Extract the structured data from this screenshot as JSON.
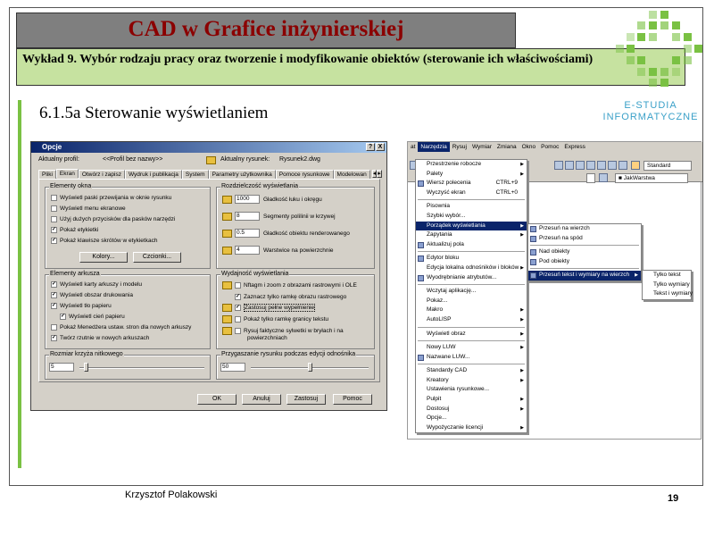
{
  "slide": {
    "title": "CAD w Grafice inżynierskiej",
    "subtitle": "Wykład 9.  Wybór rodzaju pracy oraz tworzenie i modyfikowanie obiektów (sterowanie ich właściwościami)",
    "section": "6.1.5a Sterowanie  wyświetlaniem",
    "logo_line1": "E-STUDIA",
    "logo_line2": "INFORMATYCZNE",
    "author": "Krzysztof Polakowski",
    "page_number": "19",
    "colors": {
      "title_text": "#8b0000",
      "subtitle_bg": "#c6e2a0",
      "accent_green": "#7ac143",
      "logo_blue": "#3aa0c8"
    }
  },
  "dialog": {
    "title": "Opcje",
    "title_buttons": [
      "?",
      "X"
    ],
    "profile_label": "Aktualny profil:",
    "profile_value": "<<Profil bez nazwy>>",
    "drawing_label": "Aktualny rysunek:",
    "drawing_value": "Rysunek2.dwg",
    "tabs": [
      "Pliki",
      "Ekran",
      "Otwórz i zapisz",
      "Wydruk i publikacja",
      "System",
      "Parametry użytkownika",
      "Pomoce rysunkowe",
      "Modelowan"
    ],
    "active_tab": "Ekran",
    "window_elements": {
      "label": "Elementy okna",
      "items": [
        {
          "label": "Wyświetl paski przewijania w oknie rysunku",
          "checked": false
        },
        {
          "label": "Wyświetl menu ekranowe",
          "checked": false
        },
        {
          "label": "Użyj dużych przycisków dla pasków narzędzi",
          "checked": false
        },
        {
          "label": "Pokaż etykietki",
          "checked": true
        },
        {
          "label": "Pokaż klawisze skrótów w etykietkach",
          "checked": true
        }
      ],
      "colors_button": "Kolory...",
      "fonts_button": "Czcionki..."
    },
    "layout_elements": {
      "label": "Elementy arkusza",
      "items": [
        {
          "label": "Wyświetl karty arkuszy i modelu",
          "checked": true
        },
        {
          "label": "Wyświetl obszar drukowania",
          "checked": true
        },
        {
          "label": "Wyświetl tło papieru",
          "checked": true
        },
        {
          "label": "Wyświetl cień papieru",
          "checked": true
        },
        {
          "label": "Pokaż Menedżera ustaw. stron dla nowych arkuszy",
          "checked": false
        },
        {
          "label": "Twórz rzutnie w nowych arkuszach",
          "checked": true
        }
      ]
    },
    "resolution": {
      "label": "Rozdzielczość wyświetlania",
      "items": [
        {
          "value": "1000",
          "label": "Gładkość łuku i okręgu"
        },
        {
          "value": "8",
          "label": "Segmenty polilinii w krzywej"
        },
        {
          "value": "0.5",
          "label": "Gładkość obiektu renderowanego"
        },
        {
          "value": "4",
          "label": "Warstwice na powierzchnie"
        }
      ]
    },
    "performance": {
      "label": "Wydajność wyświetlania",
      "items": [
        {
          "label": "Nftagm i zoom z obrazami rastrowymi i OLE",
          "checked": false
        },
        {
          "label": "Zaznacz tylko ramkę obrazu rastrowego",
          "checked": true
        },
        {
          "label": "Zastosuj pełne wypełnienie",
          "checked": true
        },
        {
          "label": "Pokaż tylko ramkę granicy tekstu",
          "checked": false
        },
        {
          "label": "Rysuj faktyczne sylwetki w bryłach i na",
          "label2": "powierzchniach",
          "checked": false
        }
      ]
    },
    "crosshair": {
      "label": "Rozmiar krzyża nitkowego",
      "value": "5",
      "fraction": 0.05
    },
    "fading": {
      "label": "Przygaszanie rysunku podczas edycji odnośnika",
      "value": "50",
      "fraction": 0.5
    },
    "buttons": [
      "OK",
      "Anuluj",
      "Zastosuj",
      "Pomoc"
    ]
  },
  "app": {
    "menu_bar": [
      "at",
      "Narzędzia",
      "Rysuj",
      "Wymiar",
      "Zmiana",
      "Okno",
      "Pomoc",
      "Express"
    ],
    "active_menu": "Narzędzia",
    "style_combo": "Standard",
    "layer_combo": "JakWarstwa",
    "tools_menu": [
      {
        "label": "Przestrzenie robocze",
        "arrow": true
      },
      {
        "label": "Palety",
        "arrow": true
      },
      {
        "label": "Wiersz polecenia",
        "shortcut": "CTRL+9",
        "icon": true
      },
      {
        "label": "Wyczyść ekran",
        "shortcut": "CTRL+0"
      },
      {
        "sep": true
      },
      {
        "label": "Pisownia"
      },
      {
        "label": "Szybki wybór..."
      },
      {
        "label": "Porządek wyświetlania",
        "arrow": true,
        "highlight": true
      },
      {
        "label": "Zapytania",
        "arrow": true
      },
      {
        "label": "Aktualizuj pola",
        "icon": true
      },
      {
        "sep": true
      },
      {
        "label": "Edytor bloku",
        "icon": true
      },
      {
        "label": "Edycja lokalna odnośników i bloków",
        "arrow": true
      },
      {
        "label": "Wyodrębnianie atrybutów...",
        "icon": true
      },
      {
        "sep": true
      },
      {
        "label": "Wczytaj aplikację..."
      },
      {
        "label": "Pokaz..."
      },
      {
        "label": "Makro",
        "arrow": true
      },
      {
        "label": "AutoLISP",
        "arrow": true
      },
      {
        "sep": true
      },
      {
        "label": "Wyświetl obraz",
        "arrow": true
      },
      {
        "sep": true
      },
      {
        "label": "Nowy LUW",
        "arrow": true
      },
      {
        "label": "Nazwane LUW...",
        "icon": true
      },
      {
        "sep": true
      },
      {
        "label": "Standardy CAD",
        "arrow": true
      },
      {
        "label": "Kreatory",
        "arrow": true
      },
      {
        "label": "Ustawienia rysunkowe..."
      },
      {
        "label": "Pulpit",
        "arrow": true
      },
      {
        "label": "Dostosuj",
        "arrow": true
      },
      {
        "label": "Opcje..."
      },
      {
        "label": "Wypożyczanie licencji",
        "arrow": true
      }
    ],
    "draw_order_menu": [
      {
        "label": "Przesuń na wierzch",
        "icon": true
      },
      {
        "label": "Przesuń na spód",
        "icon": true
      },
      {
        "sep": true
      },
      {
        "label": "Nad obiekty",
        "icon": true
      },
      {
        "label": "Pod obiekty",
        "icon": true
      },
      {
        "sep": true
      },
      {
        "label": "Przesuń tekst i wymiary na wierzch",
        "arrow": true,
        "highlight": true,
        "icon": true
      }
    ],
    "text_dims_menu": [
      {
        "label": "Tylko tekst"
      },
      {
        "label": "Tylko wymiary"
      },
      {
        "label": "Tekst i wymiary"
      }
    ]
  }
}
